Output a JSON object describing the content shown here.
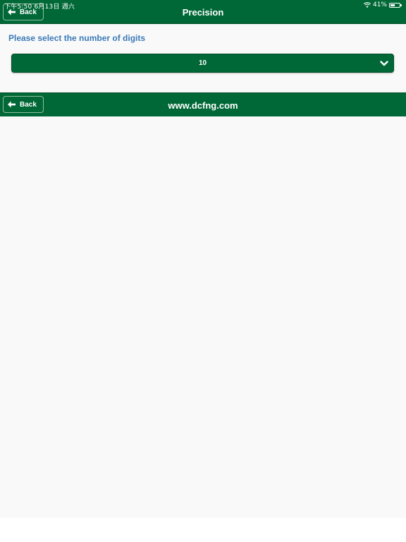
{
  "status_bar": {
    "time_date": "下午5:50  6月13日 週六",
    "battery": "41%"
  },
  "header": {
    "title": "Precision",
    "back_label": "Back"
  },
  "content": {
    "prompt": "Please select the number of digits",
    "digits_select": {
      "selected": "10"
    }
  },
  "footer": {
    "title": "www.dcfng.com",
    "back_label": "Back"
  },
  "colors": {
    "primary_green": "#006837",
    "prompt_blue": "#3a7ab8",
    "background": "#f9f9f9"
  },
  "icons": {
    "back": "arrow-left-icon",
    "select": "chevron-down-icon",
    "wifi": "wifi-icon",
    "battery": "battery-icon"
  }
}
